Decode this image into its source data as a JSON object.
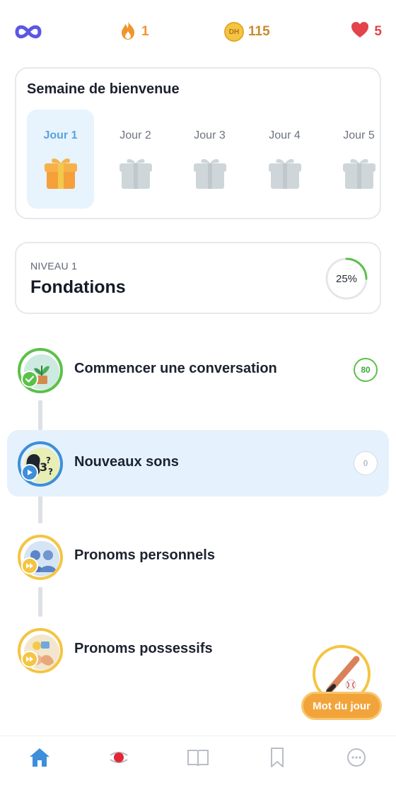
{
  "topbar": {
    "infinity_icon": "infinity-icon",
    "streak_count": "1",
    "coins_label": "DH",
    "coins_count": "115",
    "hearts_count": "5",
    "colors": {
      "infinity": "#5a57e6",
      "streak": "#f0952c",
      "coins": "#c78c2d",
      "hearts": "#e3434b"
    }
  },
  "welcome_week": {
    "title": "Semaine de bienvenue",
    "days": [
      {
        "label": "Jour 1",
        "active": true,
        "icon": "gift-open-icon"
      },
      {
        "label": "Jour 2",
        "active": false,
        "icon": "gift-locked-icon"
      },
      {
        "label": "Jour 3",
        "active": false,
        "icon": "gift-locked-icon"
      },
      {
        "label": "Jour 4",
        "active": false,
        "icon": "gift-locked-icon"
      },
      {
        "label": "Jour 5",
        "active": false,
        "icon": "gift-locked-icon"
      }
    ]
  },
  "level": {
    "label": "NIVEAU 1",
    "title": "Fondations",
    "progress_text": "25%",
    "progress": 0.25
  },
  "lessons": [
    {
      "title": "Commencer une conversation",
      "score": "80",
      "status": "completed",
      "icon": "plant-icon"
    },
    {
      "title": "Nouveaux sons",
      "score": "0",
      "status": "current",
      "icon": "sounds-icon"
    },
    {
      "title": "Pronoms personnels",
      "status": "locked",
      "icon": "people-icon"
    },
    {
      "title": "Pronoms possessifs",
      "status": "locked",
      "icon": "possessive-icon"
    }
  ],
  "word_of_day": {
    "label": "Mot du jour",
    "icon": "baseball-icon"
  },
  "bottom_nav": [
    {
      "name": "home",
      "icon": "home-icon",
      "active": true
    },
    {
      "name": "live",
      "icon": "live-icon",
      "active": false
    },
    {
      "name": "book",
      "icon": "book-icon",
      "active": false
    },
    {
      "name": "bookmark",
      "icon": "bookmark-icon",
      "active": false
    },
    {
      "name": "more",
      "icon": "more-icon",
      "active": false
    }
  ]
}
